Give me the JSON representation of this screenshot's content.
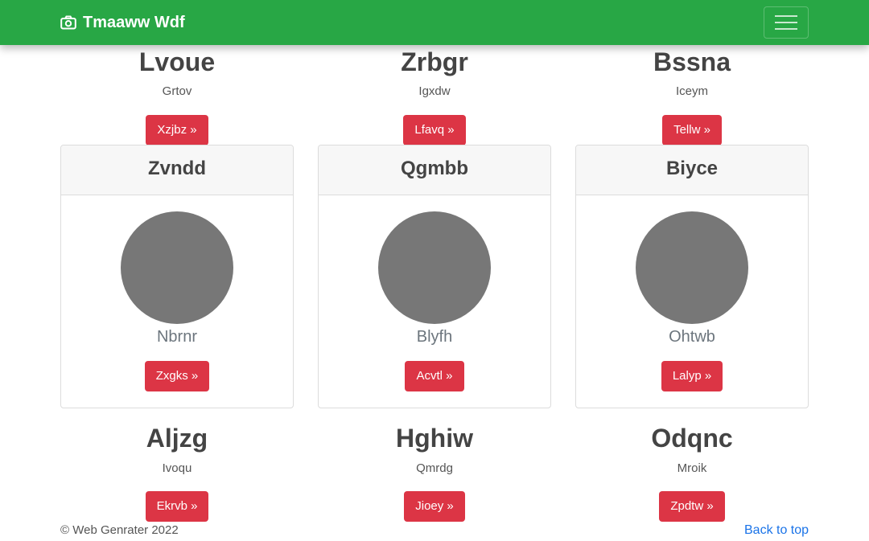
{
  "navbar": {
    "brand_icon": "camera-icon",
    "brand_text": "Tmaaww Wdf",
    "toggle_icon": "hamburger-menu-icon",
    "color": "#28a745"
  },
  "top_row": [
    {
      "title": "Lvoue",
      "subtitle": "Grtov",
      "button": "Xzjbz »"
    },
    {
      "title": "Zrbgr",
      "subtitle": "Igxdw",
      "button": "Lfavq »"
    },
    {
      "title": "Bssna",
      "subtitle": "Iceym",
      "button": "Tellw »"
    }
  ],
  "cards": [
    {
      "header": "Zvndd",
      "name": "Nbrnr",
      "button": "Zxgks »"
    },
    {
      "header": "Qgmbb",
      "name": "Blyfh",
      "button": "Acvtl »"
    },
    {
      "header": "Biyce",
      "name": "Ohtwb",
      "button": "Lalyp »"
    }
  ],
  "bottom_row": [
    {
      "title": "Aljzg",
      "subtitle": "Ivoqu",
      "button": "Ekrvb »"
    },
    {
      "title": "Hghiw",
      "subtitle": "Qmrdg",
      "button": "Jioey »"
    },
    {
      "title": "Odqnc",
      "subtitle": "Mroik",
      "button": "Zpdtw »"
    }
  ],
  "footer": {
    "copyright": "© Web Genrater 2022",
    "back_to_top": "Back to top"
  },
  "colors": {
    "button_red": "#dc3545",
    "avatar_gray": "#777777",
    "link_blue": "#1a73e8"
  }
}
